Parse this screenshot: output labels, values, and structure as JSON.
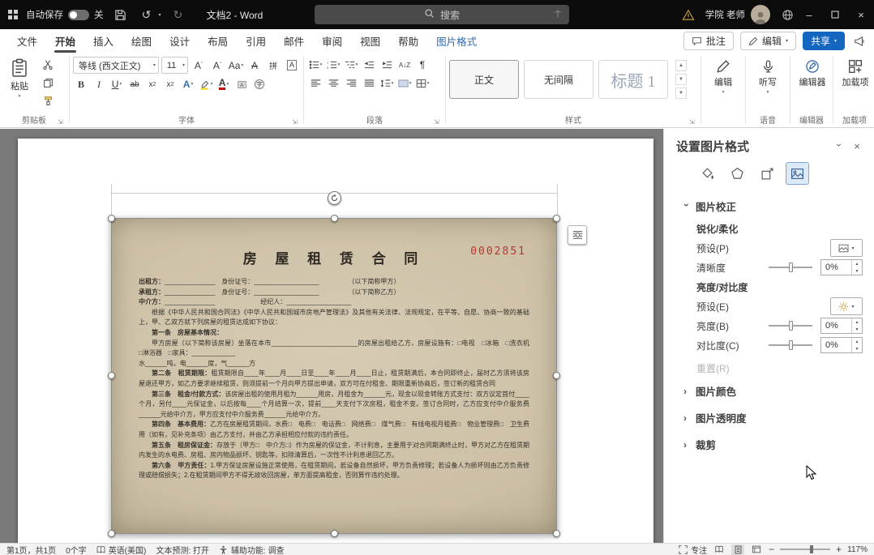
{
  "titlebar": {
    "autosave": "自动保存",
    "autosave_state": "关",
    "title": "文档2 - Word",
    "search": "搜索",
    "user": "学院 老师"
  },
  "menu": {
    "tabs": [
      "文件",
      "开始",
      "插入",
      "绘图",
      "设计",
      "布局",
      "引用",
      "邮件",
      "审阅",
      "视图",
      "帮助",
      "图片格式"
    ],
    "comments": "批注",
    "editing": "编辑",
    "share": "共享"
  },
  "ribbon": {
    "paste": "粘贴",
    "font_family": "等线 (西文正文)",
    "font_size": "11",
    "styles": [
      "正文",
      "无间隔",
      "标题 1"
    ],
    "editing": "编辑",
    "dictate": "听写",
    "editor": "编辑器",
    "addins": "加载项",
    "labels": {
      "clipboard": "剪贴板",
      "font": "字体",
      "paragraph": "段落",
      "styles": "样式",
      "voice": "语音",
      "editor": "编辑器",
      "addins": "加载项"
    }
  },
  "panel": {
    "title": "设置图片格式",
    "corrections": "图片校正",
    "sharpen": "锐化/柔化",
    "preset_p": "预设(P)",
    "sharpness": "清晰度",
    "bc": "亮度/对比度",
    "preset_e": "预设(E)",
    "brightness": "亮度(B)",
    "contrast": "对比度(C)",
    "reset": "重置(R)",
    "color": "图片颜色",
    "transparency": "图片透明度",
    "crop": "裁剪",
    "sharpness_value": "0%",
    "brightness_value": "0%",
    "contrast_value": "0%"
  },
  "document": {
    "title": "房 屋 租 赁 合 同",
    "number": "0002851",
    "lines": [
      {
        "h": "出租方：",
        "t": "______________　身份证号：__________________　　　　　（以下简称甲方）"
      },
      {
        "h": "承租方：",
        "t": "______________　身份证号：__________________　　　　　（以下简称乙方）"
      },
      {
        "h": "中介方：",
        "t": "______________　　　　　　　经纪人：__________________"
      },
      {
        "h": "",
        "t": "根据《中华人民共和国合同法》《中华人民共和国城市房地产管理法》及其他有关法律、法规规定，在平等、自愿、协商一致的基础上，甲、乙双方就下列房屋的租赁达成如下协议："
      },
      {
        "h": "第一条　房屋基本情况：",
        "t": ""
      },
      {
        "h": "",
        "t": "甲方房屋（以下简称该房屋）坐落在本市________________________的房屋出租给乙方，房屋设施有：□电视　□冰箱　□洗衣机　□淋浴器　□家具：____________"
      },
      {
        "h": "",
        "t": "水______吨，电______度，气______方"
      },
      {
        "h": "第二条　租赁期限：",
        "t": "租赁期限自____年____月____日至____年____月____日止，租赁期满后，本合同即终止，届时乙方须将该房屋退还甲方，如乙方要求继续租赁，则须提前一个月向甲方提出申请，双方可在付租金、期限重新协商后，签订新的租赁合同"
      },
      {
        "h": "第三条　租金/付款方式：",
        "t": "该房屋出租的使用月租为______用房，月租金为______元，现金以现金转账方式支付：双方议定首付____个月，另付____元保证金，以后按每____个月结算一次，提前____天支付下次房租，租金不变。签订合同时，乙方应支付中介服务费______元给中介方，甲方应支付中介服务费______元给中介方。"
      },
      {
        "h": "第四条　基本费用：",
        "t": "乙方在房屋租赁期间，水费□　电费□　电话费□　网络费□　煤气费□　有线电视月租费□　物业管理费□　卫生费用（如有，见补充条项）由乙方支付，并由乙方承担相应付款的违约责任。"
      },
      {
        "h": "第五条　租房保证金：",
        "t": "存放于（甲方□　中介方□）作为房屋的保证金，不计利息，主要用于对合同期满终止时，甲方对乙方在租赁期内发生的水电费、房租、房内物品损坏、钥匙等，扣除清算后，一次性不计利息退回乙方。"
      },
      {
        "h": "第六条　甲方责任：",
        "t": "1.甲方保证房屋设施正常使用，在租赁期间，若设备自然损坏，甲方负责修理；若设备人为损坏则由乙方负责修理或赔偿损失；2.在租赁期间甲方不得无故收回房屋，单方面提高租金，否则算作违约处理。"
      }
    ]
  },
  "statusbar": {
    "page": "第1页，共1页",
    "words": "0个字",
    "language": "英语(美国)",
    "prediction": "文本预测: 打开",
    "accessibility": "辅助功能: 调查",
    "focus": "专注",
    "zoom": "117%"
  }
}
